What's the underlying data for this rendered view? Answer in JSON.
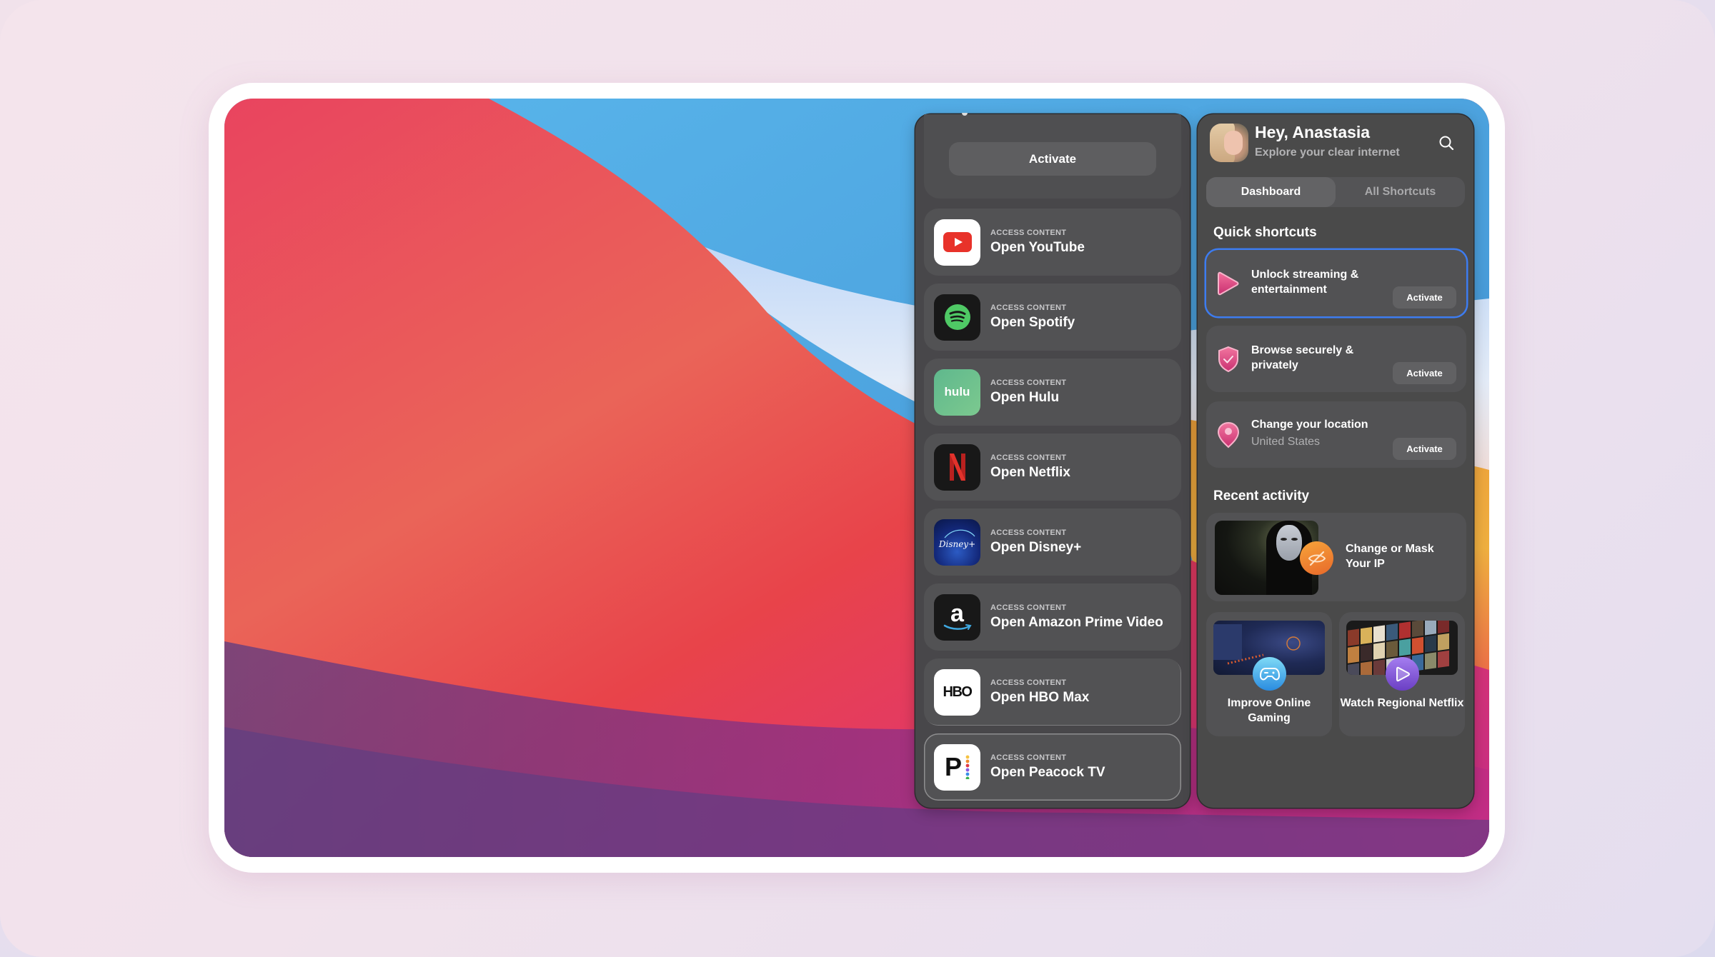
{
  "left_panel": {
    "activate_label": "Activate",
    "apps": [
      {
        "kicker": "ACCESS CONTENT",
        "title": "Open YouTube",
        "icon": "youtube-icon"
      },
      {
        "kicker": "ACCESS CONTENT",
        "title": "Open Spotify",
        "icon": "spotify-icon"
      },
      {
        "kicker": "ACCESS CONTENT",
        "title": "Open Hulu",
        "icon": "hulu-icon",
        "icon_text": "hulu"
      },
      {
        "kicker": "ACCESS CONTENT",
        "title": "Open Netflix",
        "icon": "netflix-icon",
        "icon_text": "N"
      },
      {
        "kicker": "ACCESS CONTENT",
        "title": "Open Disney+",
        "icon": "disney-plus-icon",
        "icon_text": "Disney+"
      },
      {
        "kicker": "ACCESS CONTENT",
        "title": "Open Amazon Prime Video",
        "icon": "amazon-prime-icon",
        "icon_text": "a"
      },
      {
        "kicker": "ACCESS CONTENT",
        "title": "Open HBO Max",
        "icon": "hbo-max-icon",
        "icon_text": "HBO"
      },
      {
        "kicker": "ACCESS CONTENT",
        "title": "Open Peacock TV",
        "icon": "peacock-icon",
        "icon_text": "P"
      }
    ]
  },
  "right_panel": {
    "greeting": "Hey, Anastasia",
    "subtitle": "Explore your clear internet",
    "tabs": [
      {
        "label": "Dashboard",
        "active": true
      },
      {
        "label": "All Shortcuts",
        "active": false
      }
    ],
    "quick_shortcuts_title": "Quick shortcuts",
    "quick_shortcuts": [
      {
        "title": "Unlock streaming & entertainment",
        "subtitle": "",
        "button": "Activate",
        "icon": "play-icon",
        "selected": true
      },
      {
        "title": "Browse securely & privately",
        "subtitle": "",
        "button": "Activate",
        "icon": "shield-check-icon",
        "selected": false
      },
      {
        "title": "Change your location",
        "subtitle": "United States",
        "button": "Activate",
        "icon": "location-pin-icon",
        "selected": false
      }
    ],
    "recent_activity_title": "Recent activity",
    "recent_activity": [
      {
        "title": "Change or Mask Your IP",
        "icon": "eye-off-icon"
      },
      {
        "title": "Improve Online Gaming",
        "icon": "gamepad-icon"
      },
      {
        "title": "Watch Regional Netflix",
        "icon": "play-icon"
      }
    ]
  },
  "colors": {
    "accent_blue": "#3d7cf0",
    "accent_pink": "#e0487f",
    "panel_bg": "#4a4a4a",
    "card_bg": "#525254"
  }
}
